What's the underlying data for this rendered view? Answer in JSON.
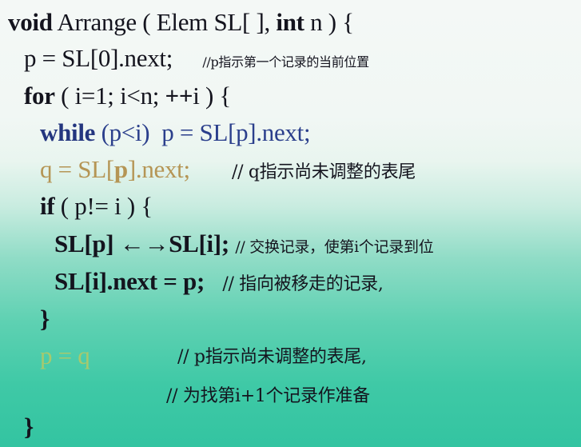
{
  "slide": {
    "lines": [
      {
        "id": "func-signature",
        "parts": [
          {
            "text": "void",
            "style": "kw"
          },
          {
            "text": " Arrange ( Elem SL[ ], ",
            "style": "normal"
          },
          {
            "text": "int",
            "style": "kw"
          },
          {
            "text": " n ) {",
            "style": "normal"
          }
        ]
      },
      {
        "id": "init-p",
        "code": "p = SL[0].next;",
        "comment": "//p指示第一个记录的当前位置"
      },
      {
        "id": "for-loop",
        "parts": [
          {
            "text": "for",
            "style": "kw"
          },
          {
            "text": " ( i=1; i<n; ",
            "style": "normal"
          },
          {
            "text": "++",
            "style": "kw"
          },
          {
            "text": "i ) {",
            "style": "normal"
          }
        ]
      },
      {
        "id": "while-loop",
        "parts": [
          {
            "text": "while",
            "style": "kw"
          },
          {
            "text": " (p<i)  p = SL[p].next;",
            "style": "normal"
          }
        ]
      },
      {
        "id": "assign-q",
        "code_pre": "q = SL[",
        "code_bold": "p",
        "code_post": "].next;",
        "comment": "// q指示尚未调整的表尾"
      },
      {
        "id": "if-stmt",
        "parts": [
          {
            "text": "if",
            "style": "kw"
          },
          {
            "text": " ( p!= i ) {",
            "style": "normal"
          }
        ]
      },
      {
        "id": "swap",
        "code": "SL[p] ←→SL[i];",
        "comment": "// 交换记录，使第i个记录到位"
      },
      {
        "id": "link-next",
        "code": "SL[i].next = p;",
        "comment": "// 指向被移走的记录,"
      },
      {
        "id": "close-if",
        "code": "}"
      },
      {
        "id": "assign-p",
        "code": "p = q",
        "comment": "// p指示尚未调整的表尾,"
      },
      {
        "id": "prep-comment",
        "comment": "// 为找第i+1个记录作准备"
      },
      {
        "id": "close-for",
        "code": "}"
      }
    ]
  }
}
